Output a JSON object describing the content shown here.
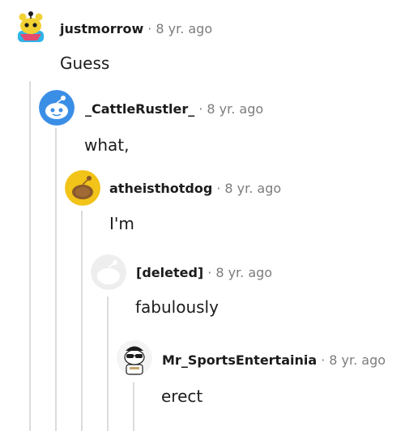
{
  "comments": [
    {
      "username": "justmorrow",
      "dot": "·",
      "age": "8 yr. ago",
      "text": "Guess",
      "avatar_icon": "snoo-yellow-avatar-icon"
    },
    {
      "username": "_CattleRustler_",
      "dot": "·",
      "age": "8 yr. ago",
      "text": "what,",
      "avatar_icon": "snoo-blue-avatar-icon"
    },
    {
      "username": "atheisthotdog",
      "dot": "·",
      "age": "8 yr. ago",
      "text": "I'm",
      "avatar_icon": "snoo-gold-avatar-icon"
    },
    {
      "username": "[deleted]",
      "dot": "·",
      "age": "8 yr. ago",
      "text": "fabulously",
      "avatar_icon": "deleted-user-avatar-icon"
    },
    {
      "username": "Mr_SportsEntertainia",
      "dot": "·",
      "age": "8 yr. ago",
      "text": "erect",
      "avatar_icon": "snoo-sunglasses-avatar-icon"
    }
  ],
  "colors": {
    "thread_line": "#dcdcdc",
    "meta_gray": "#7c7c7c",
    "text": "#1c1c1c"
  }
}
